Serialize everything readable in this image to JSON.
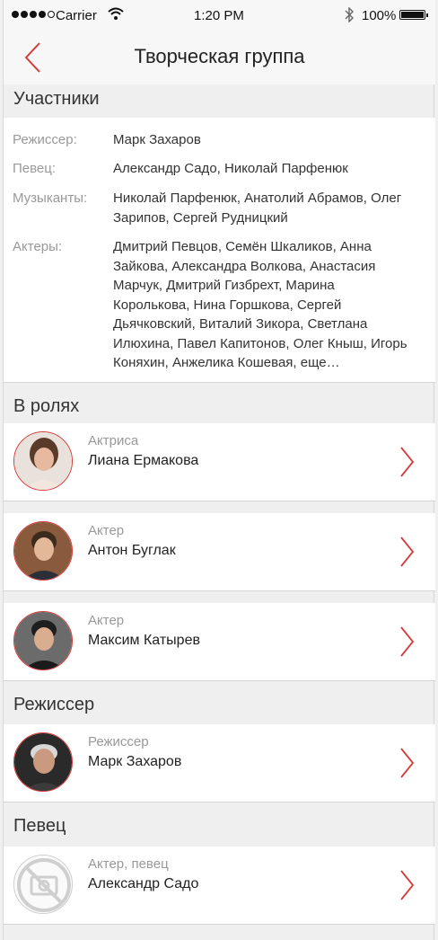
{
  "status_bar": {
    "carrier": "Carrier",
    "time": "1:20 PM",
    "battery": "100%"
  },
  "header": {
    "title": "Творческая группа"
  },
  "sections": {
    "members": {
      "title": "Участники",
      "rows": [
        {
          "key": "Режиссер:",
          "value": "Марк Захаров"
        },
        {
          "key": "Певец:",
          "value": "Александр Садо, Николай Парфенюк"
        },
        {
          "key": "Музыканты:",
          "value": "Николай Парфенюк, Анатолий Абрамов, Олег Зарипов, Сергей Рудницкий"
        },
        {
          "key": "Актеры:",
          "value": "Дмитрий Певцов, Семён Шкаликов, Анна Зайкова, Александра Волкова, Анастасия Марчук, Дмитрий Гизбрехт, Марина Королькова, Нина Горшкова, Сергей Дьячковский, Виталий Зикора, Светлана Илюхина, Павел Капитонов, Олег Кныш, Игорь Коняхин, Анжелика Кошевая, еще…"
        }
      ]
    },
    "roles": {
      "title": "В ролях",
      "people": [
        {
          "role": "Актриса",
          "name": "Лиана Ермакова"
        },
        {
          "role": "Актер",
          "name": "Антон Буглак"
        },
        {
          "role": "Актер",
          "name": "Максим Катырев"
        }
      ]
    },
    "director": {
      "title": "Режиссер",
      "people": [
        {
          "role": "Режиссер",
          "name": "Марк Захаров"
        }
      ]
    },
    "singer": {
      "title": "Певец",
      "people": [
        {
          "role": "Актер, певец",
          "name": "Александр Садо"
        }
      ]
    }
  },
  "colors": {
    "accent": "#d63b3b",
    "background": "#efefef",
    "card": "#ffffff",
    "muted": "#999999"
  }
}
